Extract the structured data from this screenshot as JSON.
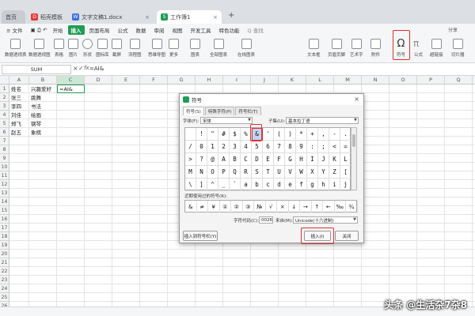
{
  "window_tabs": [
    {
      "label": "首页",
      "icon": "home-icon",
      "color": "#9aa0a6"
    },
    {
      "label": "稻壳模板",
      "icon": "docer-icon",
      "color": "#e23b3b"
    },
    {
      "label": "文字文稿1.docx",
      "icon": "writer-doc-icon",
      "color": "#3b6fe2"
    },
    {
      "label": "工作簿1",
      "icon": "spreadsheet-icon",
      "color": "#1f9d55"
    }
  ],
  "menu": {
    "file": "≡ 文件",
    "items": [
      "开始",
      "插入",
      "页面布局",
      "公式",
      "数据",
      "审阅",
      "视图",
      "开发工具",
      "特色功能"
    ],
    "active": "插入",
    "search": "Q 查找"
  },
  "toolbar": {
    "items": [
      "数据透视表",
      "数据透视图",
      "表格",
      "图片",
      "形状",
      "图标库",
      "截屏",
      "流程图",
      "思维导图",
      "更多",
      "图表",
      "全部图表",
      "在线图表",
      "文本框",
      "页眉页脚",
      "艺术字",
      "附件",
      "符号",
      "公式",
      "超链接",
      "切片器"
    ],
    "symbol_label": "符号",
    "share": "分享"
  },
  "formula_bar": {
    "namebox": "SUM",
    "content": "=AI&"
  },
  "sheet": {
    "columns": [
      "A",
      "B",
      "C",
      "D",
      "E",
      "F",
      "G",
      "H",
      "I",
      "J",
      "K",
      "L",
      "M",
      "N",
      "O",
      "P",
      "Q",
      "R",
      "S"
    ],
    "rows": [
      "1",
      "2",
      "3",
      "4",
      "5",
      "6",
      "7",
      "8",
      "9",
      "10",
      "11",
      "12",
      "13",
      "14",
      "15",
      "16",
      "17",
      "18",
      "19",
      "20",
      "21",
      "22",
      "23",
      "24",
      "25",
      "26"
    ],
    "data": [
      [
        "姓名",
        "兴趣爱好",
        "=AI&"
      ],
      [
        "张三",
        "跳舞",
        ""
      ],
      [
        "李四",
        "书法",
        ""
      ],
      [
        "刘佳",
        "绘画",
        ""
      ],
      [
        "郑飞",
        "钢琴",
        ""
      ],
      [
        "赵五",
        "象棋",
        ""
      ]
    ]
  },
  "dialog": {
    "title": "符号",
    "tabs": [
      "符号(S)",
      "特殊字符(P)",
      "符号栏(T)"
    ],
    "font_label": "字体(F):",
    "font_value": "宋体",
    "subset_label": "子集(U):",
    "subset_value": "基本拉丁语",
    "grid_rows": [
      [
        "",
        "!",
        "\"",
        "#",
        "$",
        "%",
        "&",
        "'",
        "(",
        ")",
        "*",
        "+",
        ",",
        "-",
        "."
      ],
      [
        "/",
        "0",
        "1",
        "2",
        "3",
        "4",
        "5",
        "6",
        "7",
        "8",
        "9",
        ":",
        ";",
        "<",
        "="
      ],
      [
        ">",
        "?",
        "@",
        "A",
        "B",
        "C",
        "D",
        "E",
        "F",
        "G",
        "H",
        "I",
        "J",
        "K",
        "L"
      ],
      [
        "M",
        "N",
        "O",
        "P",
        "Q",
        "R",
        "S",
        "T",
        "U",
        "V",
        "W",
        "X",
        "Y",
        "Z",
        "["
      ],
      [
        "\\",
        "]",
        "^",
        "_",
        "`",
        "a",
        "b",
        "c",
        "d",
        "e",
        "f",
        "g",
        "h",
        "i",
        "j"
      ]
    ],
    "selected": "&",
    "recent_label": "近期使用过的符号(R):",
    "recent": [
      "&",
      "≠",
      "¥",
      "①",
      "②",
      "③",
      "№",
      "√",
      "×",
      "↓",
      "→",
      "↑",
      "←",
      "‰",
      "¾"
    ],
    "code_label": "字符代码(C):",
    "code_value": "0026",
    "from_label": "来自(M):",
    "from_value": "Unicode(十六进制)",
    "insert_to_bar": "插入到符号栏(Y)",
    "insert": "插入(I)",
    "close": "关闭"
  },
  "watermark": "头条 @生活杂7杂8"
}
